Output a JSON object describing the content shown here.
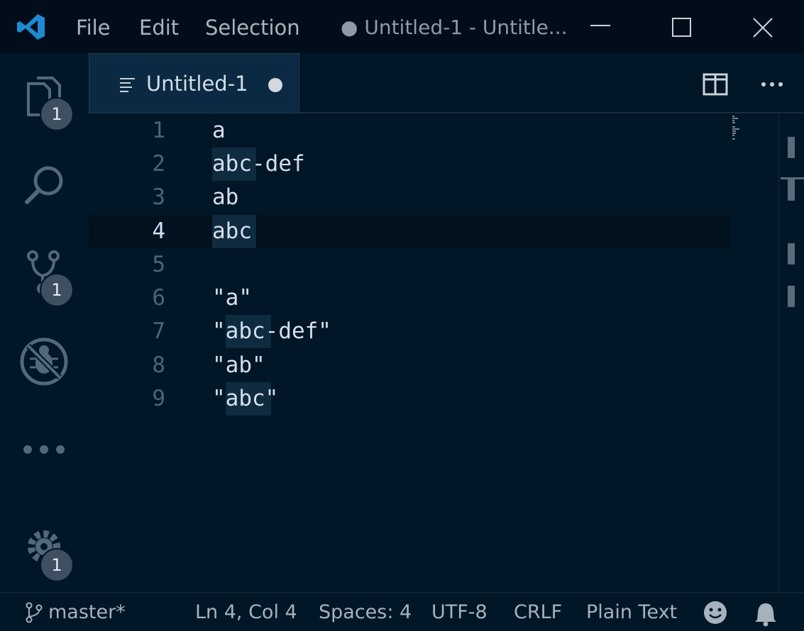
{
  "titlebar": {
    "menu": [
      "File",
      "Edit",
      "Selection"
    ],
    "title": "● Untitled-1 - Untitle..."
  },
  "activity": {
    "explorer_badge": "1",
    "scm_badge": "1",
    "settings_badge": "1"
  },
  "tabs": [
    {
      "label": "Untitled-1",
      "dirty": true
    }
  ],
  "editor": {
    "lines": [
      {
        "num": "1",
        "text": "a"
      },
      {
        "num": "2",
        "text": "abc-def"
      },
      {
        "num": "3",
        "text": "ab"
      },
      {
        "num": "4",
        "text": "abc"
      },
      {
        "num": "5",
        "text": ""
      },
      {
        "num": "6",
        "text": "\"a\""
      },
      {
        "num": "7",
        "text": "\"abc-def\""
      },
      {
        "num": "8",
        "text": "\"ab\""
      },
      {
        "num": "9",
        "text": "\"abc\""
      }
    ],
    "current_line": 4,
    "highlighted_word": "abc"
  },
  "statusbar": {
    "branch": "master*",
    "position": "Ln 4, Col 4",
    "indent": "Spaces: 4",
    "encoding": "UTF-8",
    "eol": "CRLF",
    "language": "Plain Text"
  },
  "colors": {
    "background": "#011627",
    "titlebar": "#010e1a",
    "tab_active": "#0b2942",
    "word_highlight": "#0e2b3f",
    "foreground": "#d6deeb",
    "line_number": "#4b6479"
  }
}
